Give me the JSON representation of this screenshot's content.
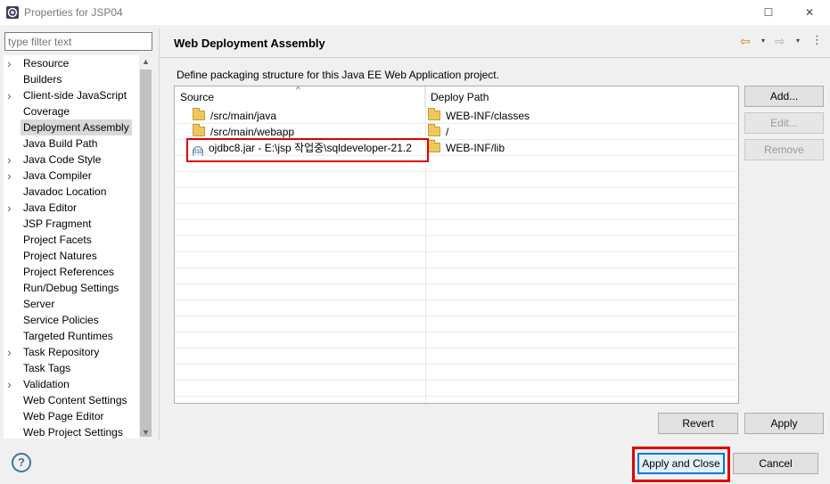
{
  "window": {
    "title": "Properties for JSP04",
    "maximize_glyph": "☐",
    "close_glyph": "✕"
  },
  "filter": {
    "placeholder": "type filter text"
  },
  "tree": {
    "items": [
      {
        "label": "Resource",
        "expandable": true
      },
      {
        "label": "Builders",
        "expandable": false
      },
      {
        "label": "Client-side JavaScript",
        "expandable": true
      },
      {
        "label": "Coverage",
        "expandable": false
      },
      {
        "label": "Deployment Assembly",
        "expandable": false,
        "selected": true
      },
      {
        "label": "Java Build Path",
        "expandable": false
      },
      {
        "label": "Java Code Style",
        "expandable": true
      },
      {
        "label": "Java Compiler",
        "expandable": true
      },
      {
        "label": "Javadoc Location",
        "expandable": false
      },
      {
        "label": "Java Editor",
        "expandable": true
      },
      {
        "label": "JSP Fragment",
        "expandable": false
      },
      {
        "label": "Project Facets",
        "expandable": false
      },
      {
        "label": "Project Natures",
        "expandable": false
      },
      {
        "label": "Project References",
        "expandable": false
      },
      {
        "label": "Run/Debug Settings",
        "expandable": false
      },
      {
        "label": "Server",
        "expandable": false
      },
      {
        "label": "Service Policies",
        "expandable": false
      },
      {
        "label": "Targeted Runtimes",
        "expandable": false
      },
      {
        "label": "Task Repository",
        "expandable": true
      },
      {
        "label": "Task Tags",
        "expandable": false
      },
      {
        "label": "Validation",
        "expandable": true
      },
      {
        "label": "Web Content Settings",
        "expandable": false
      },
      {
        "label": "Web Page Editor",
        "expandable": false
      },
      {
        "label": "Web Project Settings",
        "expandable": false
      }
    ]
  },
  "page": {
    "title": "Web Deployment Assembly",
    "description": "Define packaging structure for this Java EE Web Application project.",
    "nav": {
      "back_glyph": "⇦",
      "forward_glyph": "⇨",
      "dropdown_glyph": "▾",
      "more_glyph": "⋮"
    }
  },
  "table": {
    "columns": {
      "source": "Source",
      "deploy_path": "Deploy Path"
    },
    "rows": [
      {
        "source": "/src/main/java",
        "deploy": "WEB-INF/classes",
        "source_icon": "folder-icon"
      },
      {
        "source": "/src/main/webapp",
        "deploy": "/",
        "source_icon": "folder-icon"
      },
      {
        "source": "ojdbc8.jar - E:\\jsp 작업중\\sqldeveloper-21.2",
        "deploy": "WEB-INF/lib",
        "source_icon": "jar-icon"
      }
    ]
  },
  "buttons": {
    "add": "Add...",
    "edit": "Edit...",
    "remove": "Remove",
    "revert": "Revert",
    "apply": "Apply",
    "apply_and_close": "Apply and Close",
    "cancel": "Cancel",
    "help": "?"
  },
  "colors": {
    "highlight": "#e00000",
    "selection": "#d9d9d9",
    "focus": "#0078d7"
  }
}
